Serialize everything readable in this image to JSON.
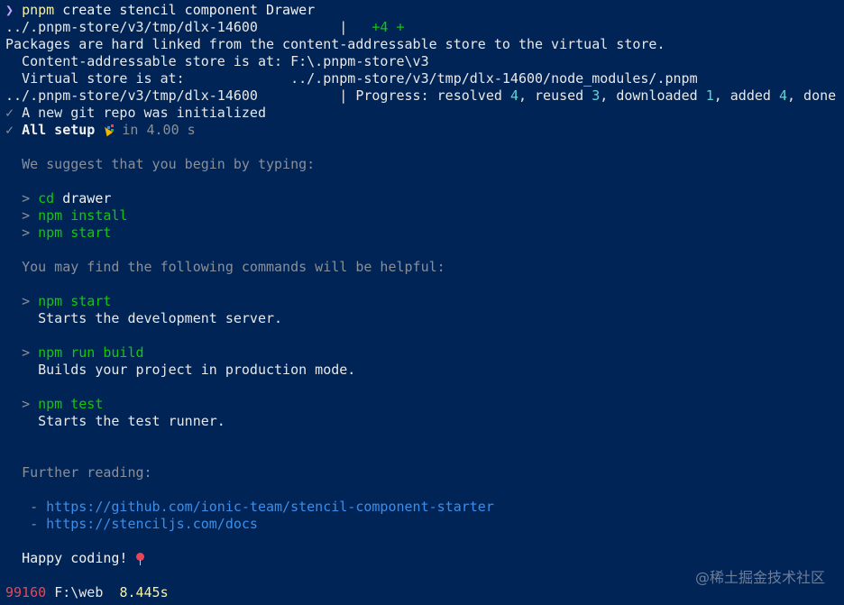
{
  "prompt": {
    "arrow": "❯",
    "command": "pnpm",
    "args": "create stencil component Drawer"
  },
  "log": {
    "progress_path_1": "../.pnpm-store/v3/tmp/dlx-14600",
    "progress_sep_1": "|",
    "progress_added": "+4 +",
    "hardlink_notice": "Packages are hard linked from the content-addressable store to the virtual store.",
    "content_store_label": "  Content-addressable store is at: ",
    "content_store_value": "F:\\.pnpm-store\\v3",
    "virtual_store_label": "  Virtual store is at:             ",
    "virtual_store_value": "../.pnpm-store/v3/tmp/dlx-14600/node_modules/.pnpm",
    "progress_path_2": "../.pnpm-store/v3/tmp/dlx-14600",
    "progress_sep_2": "|",
    "progress_label": "Progress: resolved ",
    "resolved": "4",
    "reused_label": ", reused ",
    "reused": "3",
    "downloaded_label": ", downloaded ",
    "downloaded": "1",
    "added_label": ", added ",
    "added": "4",
    "done_label": ", done"
  },
  "setup": {
    "check": "✓",
    "git_msg": "A new git repo was initialized",
    "all_setup": "All setup",
    "elapsed": "in 4.00 s"
  },
  "suggest": {
    "heading": "We suggest that you begin by typing:",
    "caret": ">",
    "cmd1_name": "cd",
    "cmd1_arg": "drawer",
    "cmd2": "npm install",
    "cmd3": "npm start"
  },
  "helpful": {
    "heading": "You may find the following commands will be helpful:",
    "items": [
      {
        "cmd": "npm start",
        "desc": "Starts the development server."
      },
      {
        "cmd": "npm run build",
        "desc": "Builds your project in production mode."
      },
      {
        "cmd": "npm test",
        "desc": "Starts the test runner."
      }
    ]
  },
  "reading": {
    "heading": "Further reading:",
    "dash": "-",
    "links": [
      "https://github.com/ionic-team/stencil-component-starter",
      "https://stenciljs.com/docs"
    ]
  },
  "footer": {
    "happy": "Happy coding!"
  },
  "status": {
    "pid": "99160",
    "cwd": "F:\\web",
    "duration": "8.445s"
  },
  "watermark": "@稀土掘金技术社区"
}
